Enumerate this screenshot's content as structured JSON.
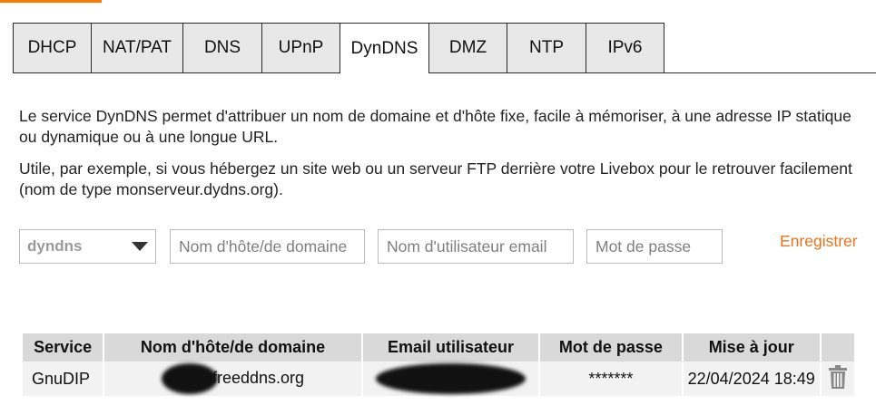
{
  "tabs": [
    {
      "label": "DHCP",
      "active": false
    },
    {
      "label": "NAT/PAT",
      "active": false
    },
    {
      "label": "DNS",
      "active": false
    },
    {
      "label": "UPnP",
      "active": false
    },
    {
      "label": "DynDNS",
      "active": true
    },
    {
      "label": "DMZ",
      "active": false
    },
    {
      "label": "NTP",
      "active": false
    },
    {
      "label": "IPv6",
      "active": false
    }
  ],
  "description": {
    "p1": "Le service DynDNS permet d'attribuer un nom de domaine et d'hôte fixe, facile à mémoriser, à une adresse IP statique ou dynamique ou à une longue URL.",
    "p2": "Utile, par exemple, si vous hébergez un site web ou un serveur FTP derrière votre Livebox pour le retrouver facilement (nom de type monserveur.dydns.org)."
  },
  "form": {
    "service_select": "dyndns",
    "host_placeholder": "Nom d'hôte/de domaine",
    "email_placeholder": "Nom d'utilisateur email",
    "password_placeholder": "Mot de passe",
    "save_label": "Enregistrer"
  },
  "table": {
    "headers": [
      "Service",
      "Nom d'hôte/de domaine",
      "Email utilisateur",
      "Mot de passe",
      "Mise à jour"
    ],
    "rows": [
      {
        "service": "GnuDIP",
        "host": "freeddns.org",
        "email": "",
        "password": "*******",
        "updated": "22/04/2024 18:49"
      }
    ]
  },
  "colors": {
    "accent": "#ff7900",
    "link": "#e8731b",
    "header_bg": "#d9d9d9",
    "row_bg": "#f2f2f2"
  },
  "icons": {
    "dropdown": "caret-down-icon",
    "delete": "trash-icon"
  }
}
